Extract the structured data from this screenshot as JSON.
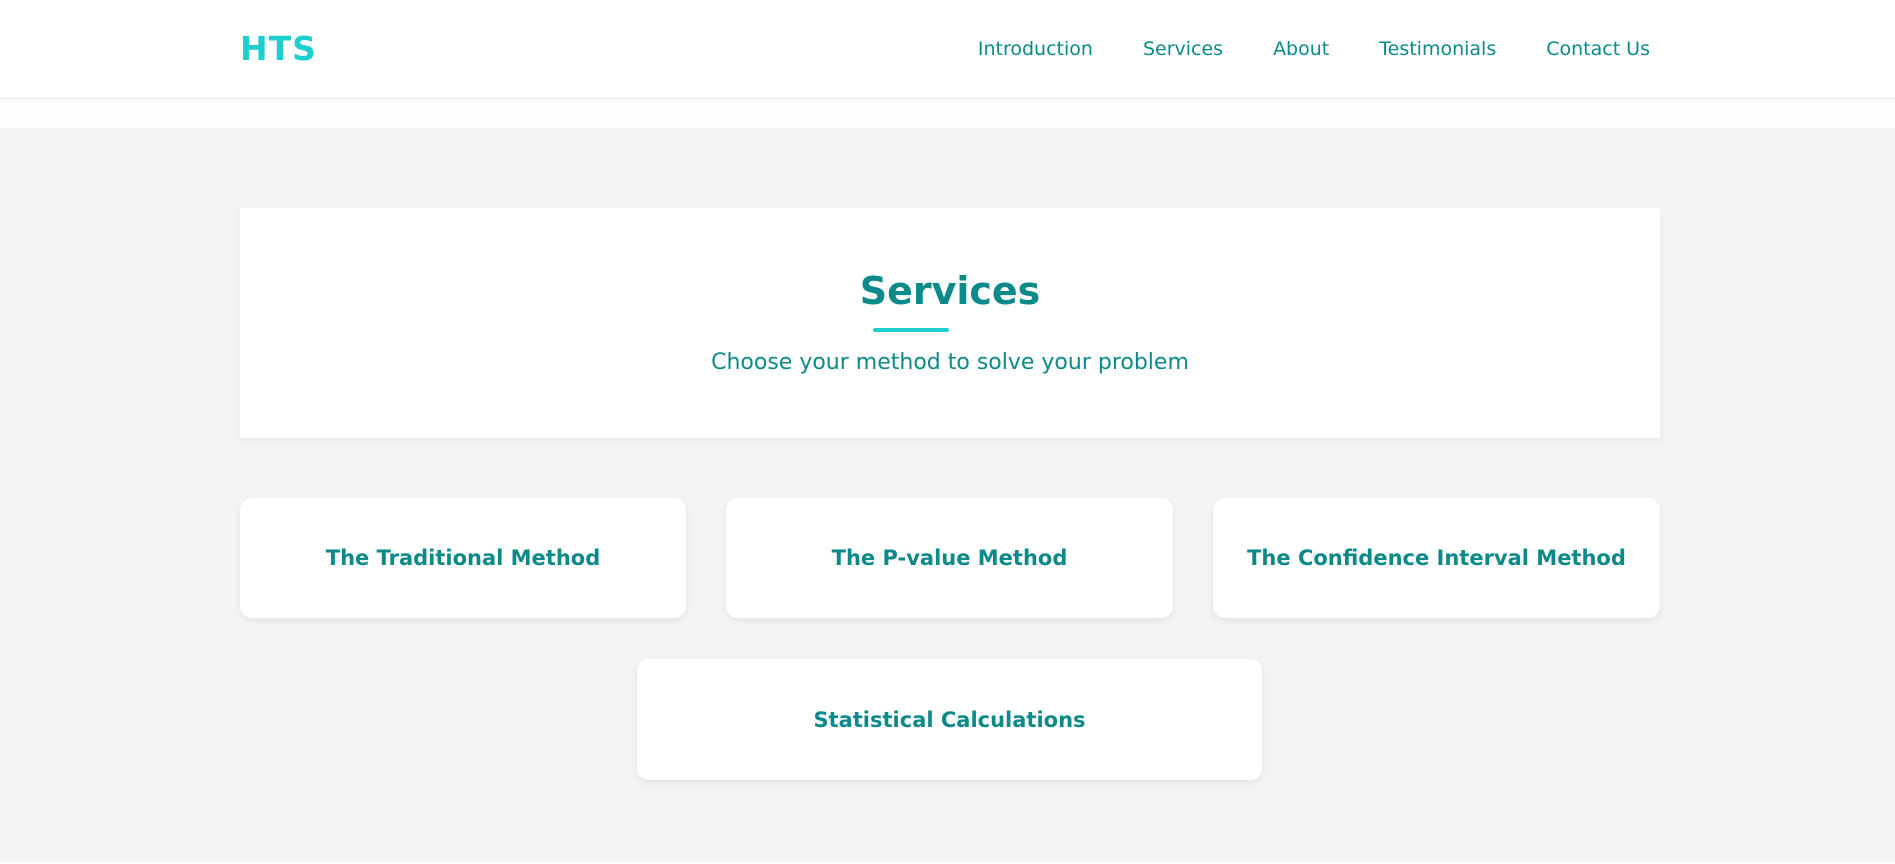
{
  "header": {
    "logo": "HTS",
    "nav": [
      {
        "label": "Introduction"
      },
      {
        "label": "Services"
      },
      {
        "label": "About"
      },
      {
        "label": "Testimonials"
      },
      {
        "label": "Contact Us"
      }
    ]
  },
  "services": {
    "title": "Services",
    "subtitle": "Choose your method to solve your problem",
    "methods": [
      {
        "label": "The Traditional Method"
      },
      {
        "label": "The P-value Method"
      },
      {
        "label": "The Confidence Interval Method"
      },
      {
        "label": "Statistical Calculations"
      }
    ]
  },
  "colors": {
    "accent": "#1ecfcf",
    "text": "#0b8a89",
    "background": "#f4f4f4",
    "card": "#ffffff"
  }
}
